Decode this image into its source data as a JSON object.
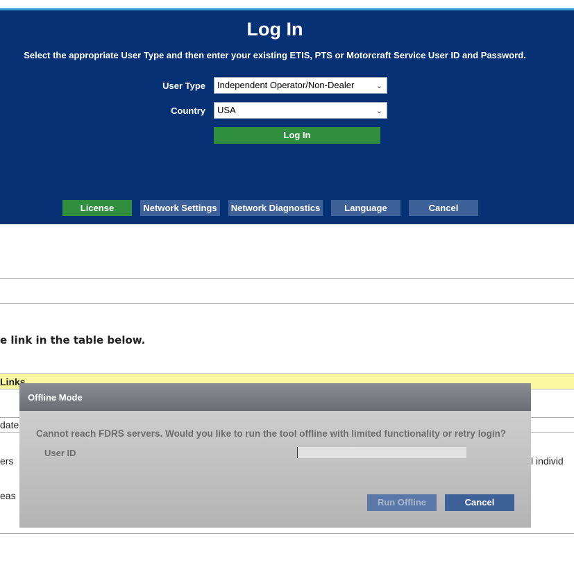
{
  "login": {
    "title": "Log In",
    "instructions": "Select the appropriate User Type and then enter your existing ETIS, PTS or Motorcraft Service User ID and Password.",
    "user_type_label": "User Type",
    "user_type_value": "Independent Operator/Non-Dealer",
    "country_label": "Country",
    "country_value": "USA",
    "login_button": "Log In",
    "buttons": {
      "license": "License",
      "network_settings": "Network Settings",
      "network_diagnostics": "Network Diagnostics",
      "language": "Language",
      "cancel": "Cancel"
    },
    "colors": {
      "panel": "#063275",
      "green": "#2f8f3e",
      "button_blue": "#3e6199"
    }
  },
  "background_page": {
    "instruction_fragment": "e link in the table below.",
    "links_fragment": "Links",
    "update_fragment": "date",
    "users_fragment": "ers",
    "individual_fragment": "l individ",
    "please_fragment": "eas"
  },
  "offline_dialog": {
    "title": "Offline Mode",
    "message": "Cannot reach FDRS servers.  Would you like to run the tool offline with limited functionality or retry login?",
    "user_id_label": "User ID",
    "user_id_value": "",
    "run_offline_button": "Run Offline",
    "cancel_button": "Cancel"
  }
}
